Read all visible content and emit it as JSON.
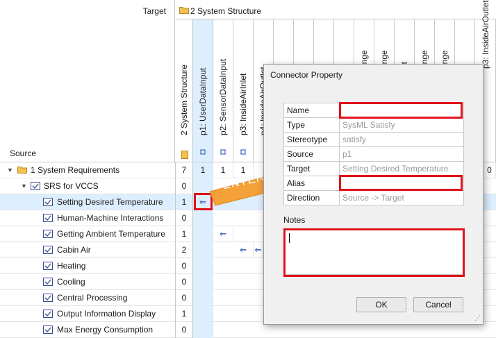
{
  "matrix": {
    "target_label": "Target",
    "source_label": "Source",
    "top_header_title": "2 System Structure",
    "columns": [
      {
        "label": "2 System Structure"
      },
      {
        "label": "p1: UserDataInput"
      },
      {
        "label": "p2: SensorDataInput"
      },
      {
        "label": "p3: InsideAirInlet"
      },
      {
        "label": "p4: InsideAirOutlet"
      },
      {
        "label": "ange"
      },
      {
        "label": "ange"
      },
      {
        "label": "nt"
      },
      {
        "label": "ange"
      },
      {
        "label": "ange"
      },
      {
        "label": "t"
      },
      {
        "label": "ange"
      },
      {
        "label": "ange"
      },
      {
        "label": "p3: InsideAirOutlet"
      }
    ],
    "rows": [
      {
        "label": "1 System Requirements",
        "count": "7",
        "cells": [
          "1",
          "1",
          "1"
        ],
        "right_cell": "0"
      },
      {
        "label": "SRS for VCCS",
        "count": "0"
      },
      {
        "label": "Setting Desired Temperature",
        "count": "1"
      },
      {
        "label": "Human-Machine Interactions",
        "count": "0"
      },
      {
        "label": "Getting Ambient Temperature",
        "count": "1"
      },
      {
        "label": "Cabin Air",
        "count": "2"
      },
      {
        "label": "Heating",
        "count": "0"
      },
      {
        "label": "Cooling",
        "count": "0"
      },
      {
        "label": "Central Processing",
        "count": "0"
      },
      {
        "label": "Output Information Display",
        "count": "1"
      },
      {
        "label": "Max Energy Consumption",
        "count": "0"
      }
    ],
    "arrow_symbol": "⇐"
  },
  "annotation": {
    "enter_label": "ENTER",
    "arrow_color": "#f5a13a",
    "highlight_color": "#e0121b"
  },
  "dialog": {
    "title": "Connector Property",
    "properties": [
      {
        "key": "Name",
        "value": ""
      },
      {
        "key": "Type",
        "value": "SysML Satisfy"
      },
      {
        "key": "Stereotype",
        "value": "satisfy"
      },
      {
        "key": "Source",
        "value": "p1"
      },
      {
        "key": "Target",
        "value": "Setting Desired Temperature"
      },
      {
        "key": "Alias",
        "value": ""
      },
      {
        "key": "Direction",
        "value": "Source -> Target"
      }
    ],
    "notes_label": "Notes",
    "notes_value": "",
    "ok_label": "OK",
    "cancel_label": "Cancel"
  }
}
